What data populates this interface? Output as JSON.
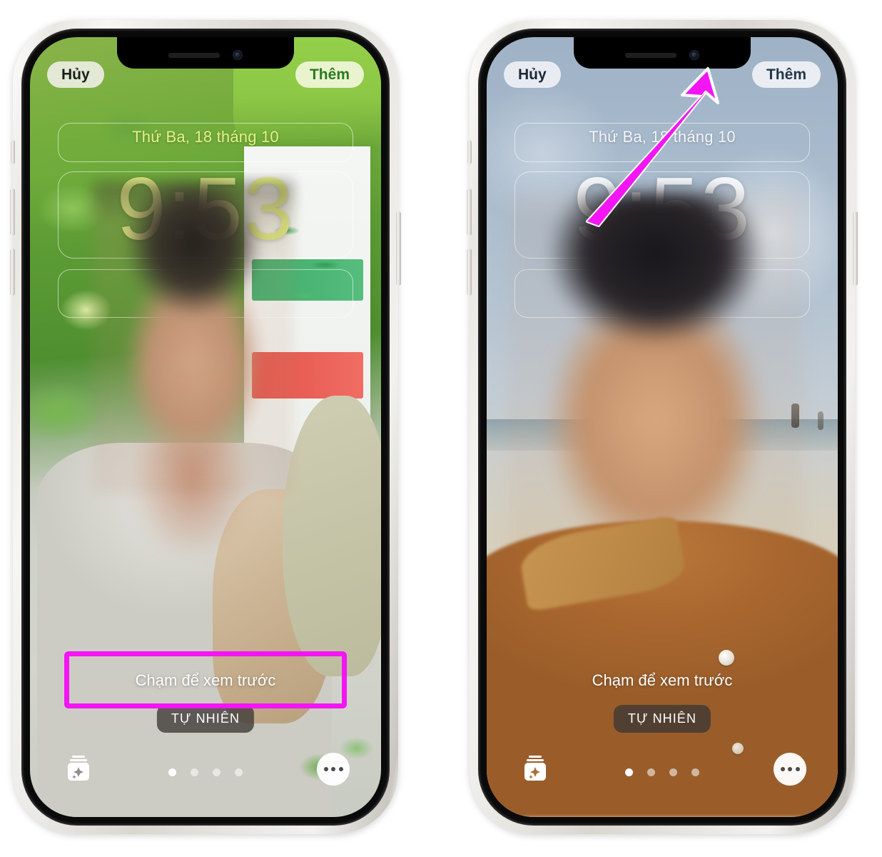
{
  "annotation": {
    "arrow_color": "#f315f3",
    "arrow_outline_color": "#ffffff",
    "highlight_box_color": "#f315f3",
    "arrow_target": "Thêm",
    "highlight_target": "Chạm để xem trước"
  },
  "phones": [
    {
      "id": "left",
      "variant": "garden-wallpaper",
      "topbar": {
        "cancel_label": "Hủy",
        "add_label": "Thêm",
        "cancel_bg": "#ecefe2",
        "add_bg": "#eef6d6",
        "add_color": "#2b7a1f"
      },
      "lockscreen": {
        "date": "Thứ Ba, 18 tháng 10",
        "time": "9:53",
        "date_color": "#e6f08a",
        "time_color": "#e4f186"
      },
      "bottom": {
        "tap_hint": "Chạm để xem trước",
        "style_chip": "TỰ NHIÊN",
        "page_dots": 4,
        "active_dot": 0,
        "effects_icon": "photo-stack-sparkle-icon",
        "more_icon": "ellipsis-icon"
      },
      "has_highlight_box": true
    },
    {
      "id": "right",
      "variant": "beach-wallpaper",
      "topbar": {
        "cancel_label": "Hủy",
        "add_label": "Thêm",
        "cancel_bg": "#eef1f5",
        "add_bg": "#eef1f5",
        "add_color": "#23364b"
      },
      "lockscreen": {
        "date": "Thứ Ba, 18 tháng 10",
        "time": "9:53",
        "date_color": "#f2f5f8",
        "time_color": "#f4f7fa"
      },
      "bottom": {
        "tap_hint": "Chạm để xem trước",
        "style_chip": "TỰ NHIÊN",
        "page_dots": 4,
        "active_dot": 0,
        "effects_icon": "photo-stack-sparkle-icon",
        "more_icon": "ellipsis-icon"
      },
      "has_highlight_box": false
    }
  ]
}
